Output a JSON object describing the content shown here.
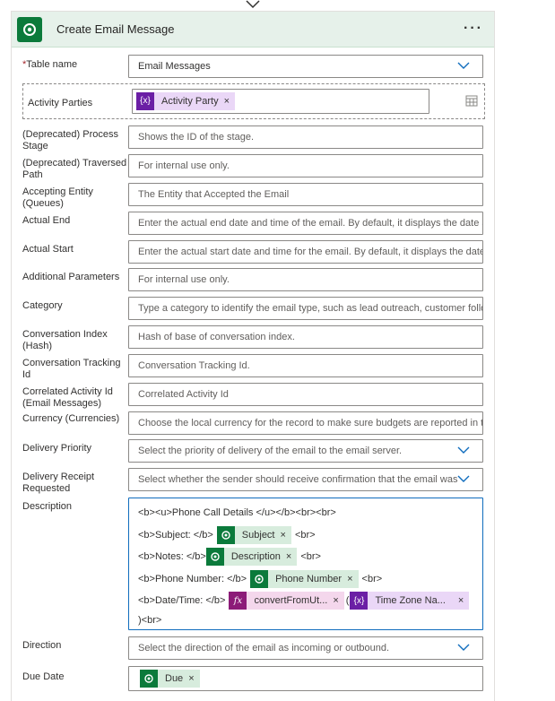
{
  "header": {
    "title": "Create Email Message",
    "more": "···"
  },
  "fields": {
    "table_name": {
      "label": "Table name",
      "value": "Email Messages"
    },
    "activity_parties": {
      "label": "Activity Parties",
      "token": "Activity Party"
    },
    "process_stage": {
      "label": "(Deprecated) Process Stage",
      "placeholder": "Shows the ID of the stage."
    },
    "traversed_path": {
      "label": "(Deprecated) Traversed Path",
      "placeholder": "For internal use only."
    },
    "accepting_entity": {
      "label": "Accepting Entity (Queues)",
      "placeholder": "The Entity that Accepted the Email"
    },
    "actual_end": {
      "label": "Actual End",
      "placeholder": "Enter the actual end date and time of the email. By default, it displays the date a"
    },
    "actual_start": {
      "label": "Actual Start",
      "placeholder": "Enter the actual start date and time for the email. By default, it displays the date"
    },
    "additional_parameters": {
      "label": "Additional Parameters",
      "placeholder": "For internal use only."
    },
    "category": {
      "label": "Category",
      "placeholder": "Type a category to identify the email type, such as lead outreach, customer follo"
    },
    "conversation_index": {
      "label": "Conversation Index (Hash)",
      "placeholder": "Hash of base of conversation index."
    },
    "conversation_tracking": {
      "label": "Conversation Tracking Id",
      "placeholder": "Conversation Tracking Id."
    },
    "correlated_activity": {
      "label": "Correlated Activity Id (Email Messages)",
      "placeholder": "Correlated Activity Id"
    },
    "currency": {
      "label": "Currency (Currencies)",
      "placeholder": "Choose the local currency for the record to make sure budgets are reported in t"
    },
    "delivery_priority": {
      "label": "Delivery Priority",
      "placeholder": "Select the priority of delivery of the email to the email server."
    },
    "delivery_receipt": {
      "label": "Delivery Receipt Requested",
      "placeholder": "Select whether the sender should receive confirmation that the email was"
    },
    "description": {
      "label": "Description",
      "line1": "<b><u>Phone Call Details </u></b><br><br>",
      "line2_pre": "<b>Subject: </b>",
      "subject_token": "Subject",
      "line2_post": "<br>",
      "line3_pre": "<b>Notes: </b>",
      "desc_token": "Description",
      "line3_post": "<br>",
      "line4_pre": "<b>Phone Number: </b>",
      "phone_token": "Phone Number",
      "line4_post": "<br>",
      "line5_pre": "<b>Date/Time: </b>",
      "convert_token": "convertFromUt...",
      "paren": "(",
      "tz_token": "Time Zone Na...",
      "line6": ")<br>"
    },
    "direction": {
      "label": "Direction",
      "placeholder": "Select the direction of the email as incoming or outbound."
    },
    "due_date": {
      "label": "Due Date",
      "token": "Due"
    }
  },
  "token_close": "×",
  "icons": {
    "expr": "{x}",
    "fx": "fx"
  }
}
